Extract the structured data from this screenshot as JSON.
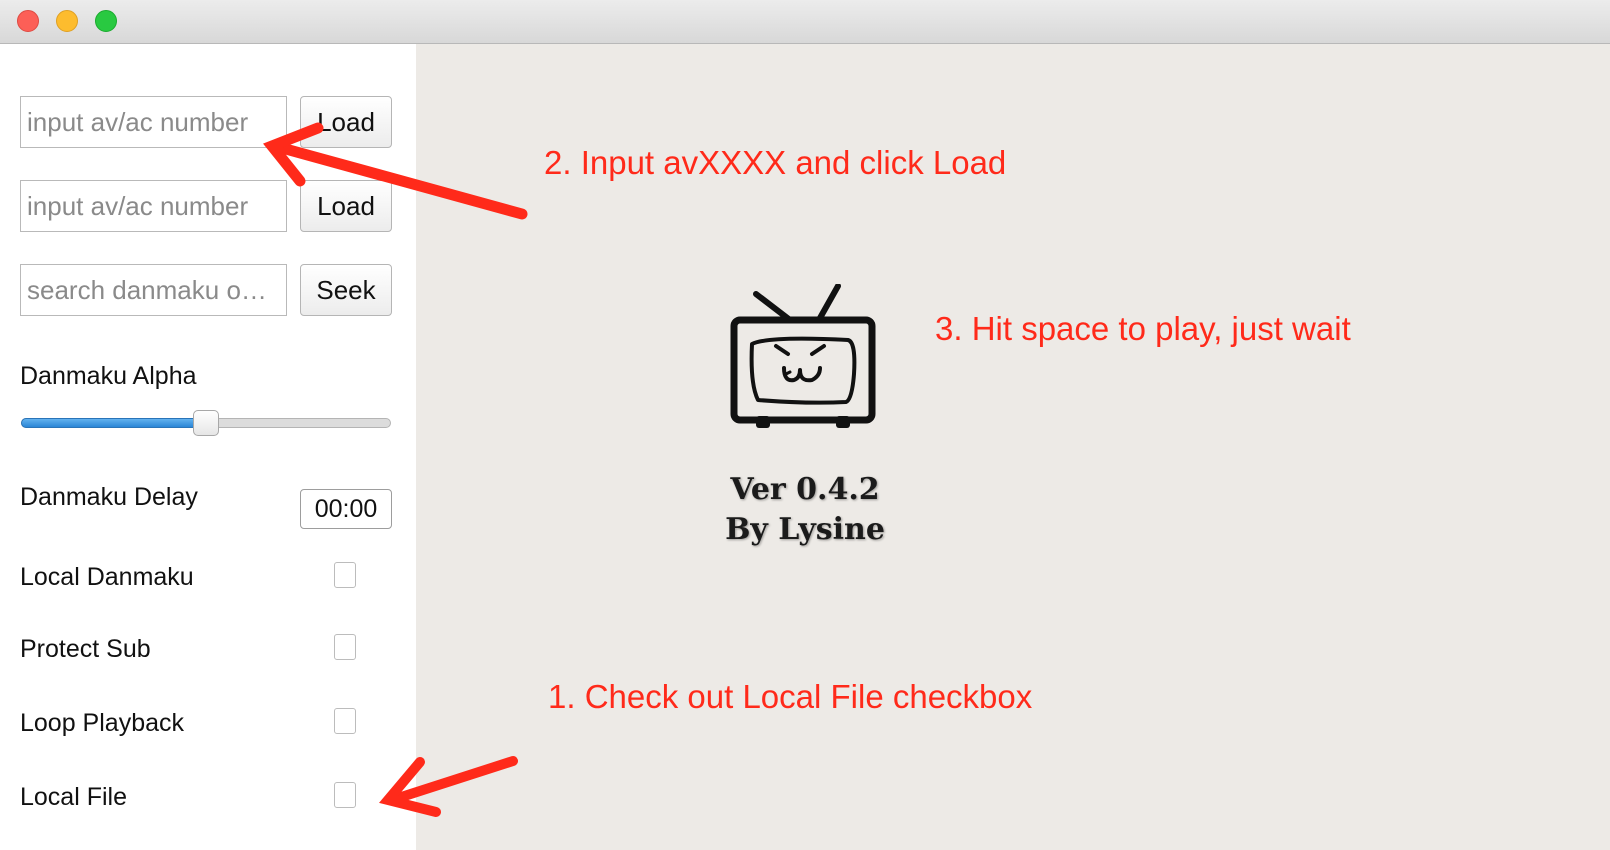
{
  "window": {
    "controls": {
      "close": "close-button",
      "minimize": "minimize-button",
      "zoom": "zoom-button"
    }
  },
  "sidebar": {
    "inputs": [
      {
        "placeholder": "input av/ac number",
        "button": "Load"
      },
      {
        "placeholder": "input av/ac number",
        "button": "Load"
      },
      {
        "placeholder": "search danmaku o…",
        "button": "Seek"
      }
    ],
    "alpha": {
      "label": "Danmaku Alpha",
      "value": 0.5
    },
    "delay": {
      "label": "Danmaku Delay",
      "value": "00:00"
    },
    "checkboxes": [
      {
        "label": "Local Danmaku",
        "checked": false
      },
      {
        "label": "Protect Sub",
        "checked": false
      },
      {
        "label": "Loop Playback",
        "checked": false
      },
      {
        "label": "Local File",
        "checked": false
      }
    ]
  },
  "player": {
    "logo_icon": "bilibili-tv-icon",
    "version": "Ver 0.4.2",
    "author": "By Lysine",
    "background": "#edeae6"
  },
  "annotations": {
    "step1": "1. Check out Local File checkbox",
    "step2": "2. Input avXXXX and click Load",
    "step3": "3. Hit space to play, just wait",
    "color": "#ff2a1a"
  }
}
